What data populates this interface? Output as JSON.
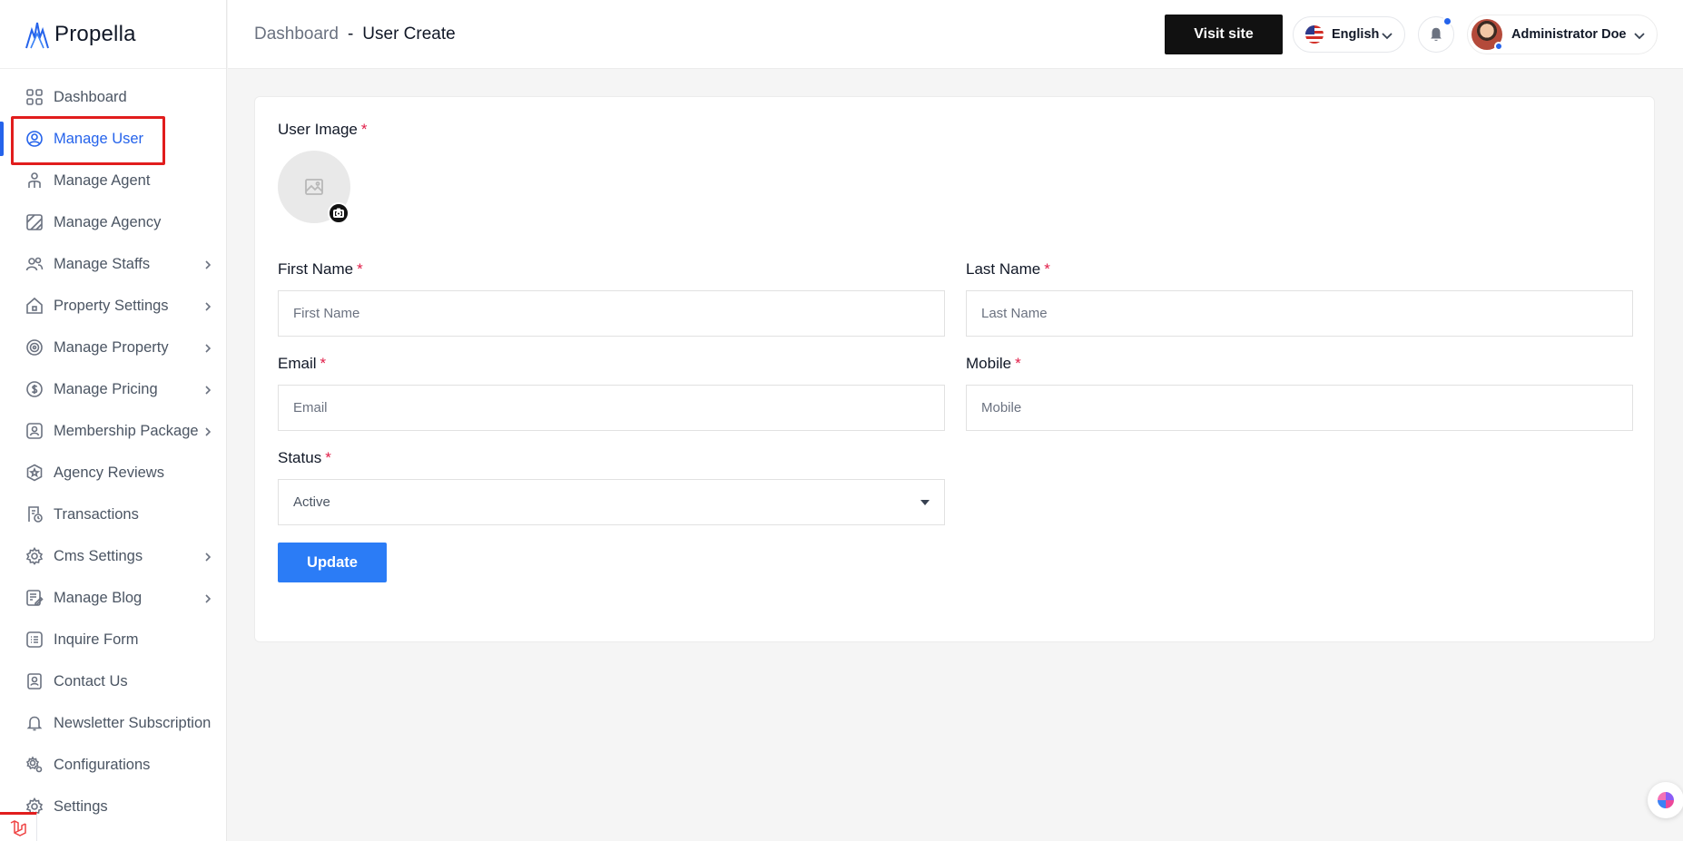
{
  "brand": {
    "name": "Propella"
  },
  "sidebar": {
    "items": [
      {
        "label": "Dashboard",
        "icon": "dashboard-grid-icon",
        "has_submenu": false
      },
      {
        "label": "Manage User",
        "icon": "user-circle-icon",
        "has_submenu": false,
        "active": true
      },
      {
        "label": "Manage Agent",
        "icon": "agent-icon",
        "has_submenu": false
      },
      {
        "label": "Manage Agency",
        "icon": "agency-icon",
        "has_submenu": false
      },
      {
        "label": "Manage Staffs",
        "icon": "users-icon",
        "has_submenu": true
      },
      {
        "label": "Property Settings",
        "icon": "home-icon",
        "has_submenu": true
      },
      {
        "label": "Manage Property",
        "icon": "property-gear-icon",
        "has_submenu": true
      },
      {
        "label": "Manage Pricing",
        "icon": "dollar-circle-icon",
        "has_submenu": true
      },
      {
        "label": "Membership Package",
        "icon": "membership-icon",
        "has_submenu": true
      },
      {
        "label": "Agency Reviews",
        "icon": "star-badge-icon",
        "has_submenu": false
      },
      {
        "label": "Transactions",
        "icon": "receipt-clock-icon",
        "has_submenu": false
      },
      {
        "label": "Cms Settings",
        "icon": "cms-gear-icon",
        "has_submenu": true
      },
      {
        "label": "Manage Blog",
        "icon": "blog-edit-icon",
        "has_submenu": true
      },
      {
        "label": "Inquire Form",
        "icon": "list-icon",
        "has_submenu": false
      },
      {
        "label": "Contact Us",
        "icon": "contact-card-icon",
        "has_submenu": false
      },
      {
        "label": "Newsletter Subscription",
        "icon": "bell-outline-icon",
        "has_submenu": false
      },
      {
        "label": "Configurations",
        "icon": "gears-icon",
        "has_submenu": false
      },
      {
        "label": "Settings",
        "icon": "settings-icon",
        "has_submenu": false
      }
    ]
  },
  "header": {
    "breadcrumb_root": "Dashboard",
    "breadcrumb_sep": "-",
    "breadcrumb_current": "User Create",
    "visit_site": "Visit site",
    "language": "English",
    "user_name": "Administrator Doe"
  },
  "form": {
    "user_image_label": "User Image",
    "required_mark": "*",
    "first_name": {
      "label": "First Name",
      "placeholder": "First Name",
      "value": ""
    },
    "last_name": {
      "label": "Last Name",
      "placeholder": "Last Name",
      "value": ""
    },
    "email": {
      "label": "Email",
      "placeholder": "Email",
      "value": ""
    },
    "mobile": {
      "label": "Mobile",
      "placeholder": "Mobile",
      "value": ""
    },
    "status": {
      "label": "Status",
      "selected": "Active"
    },
    "submit_label": "Update"
  },
  "colors": {
    "accent": "#2563eb",
    "button_primary": "#2b7cf6",
    "visit_button": "#111111",
    "highlight": "#e11d1d",
    "required": "#e11d48"
  }
}
